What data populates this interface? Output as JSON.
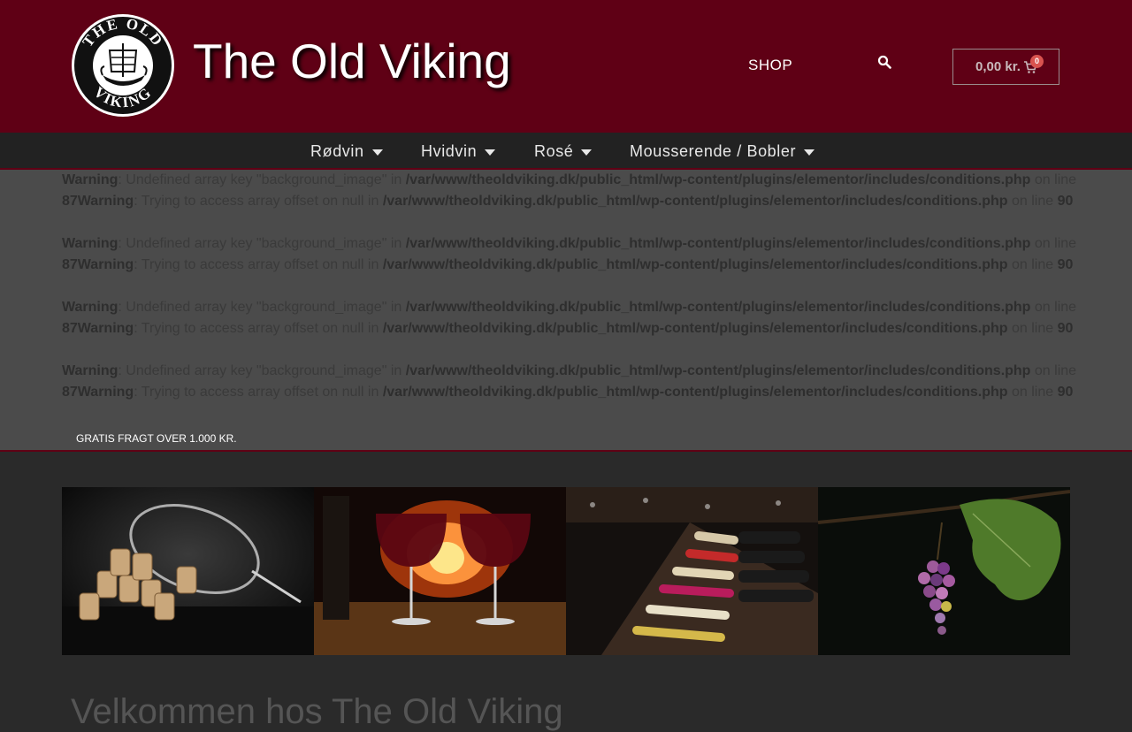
{
  "header": {
    "logo_text_top": "THE OLD",
    "logo_text_bottom": "VIKING",
    "site_title": "The Old Viking",
    "shop_label": "SHOP",
    "cart_total": "0,00 kr.",
    "cart_count": "0",
    "icons": [
      "search-icon",
      "cart-icon"
    ]
  },
  "nav": {
    "items": [
      {
        "label": "Rødvin"
      },
      {
        "label": "Hvidvin"
      },
      {
        "label": "Rosé"
      },
      {
        "label": "Mousserende / Bobler"
      }
    ]
  },
  "warnings": {
    "warning_label": "Warning",
    "undefined_msg": ": Undefined array key \"background_image\" in ",
    "offset_msg": ": Trying to access array offset on null in ",
    "path": "/var/www/theoldviking.dk/public_html/wp-content/plugins/elementor/includes/conditions.php",
    "on_line": " on line ",
    "line1": "87",
    "line2": "90"
  },
  "promo": {
    "free_shipping": "GRATIS FRAGT OVER 1.000 KR."
  },
  "gallery": {
    "images": [
      "wine-glass-corks-image",
      "fireplace-wine-glasses-image",
      "wine-shelf-bottles-image",
      "grapes-vine-image"
    ]
  },
  "welcome": {
    "heading": "Velkommen hos The Old Viking"
  },
  "colors": {
    "brand": "#5f0015",
    "nav_bg": "#222222",
    "page_bg": "#2a2a2a",
    "cart_badge": "#d9534f"
  }
}
